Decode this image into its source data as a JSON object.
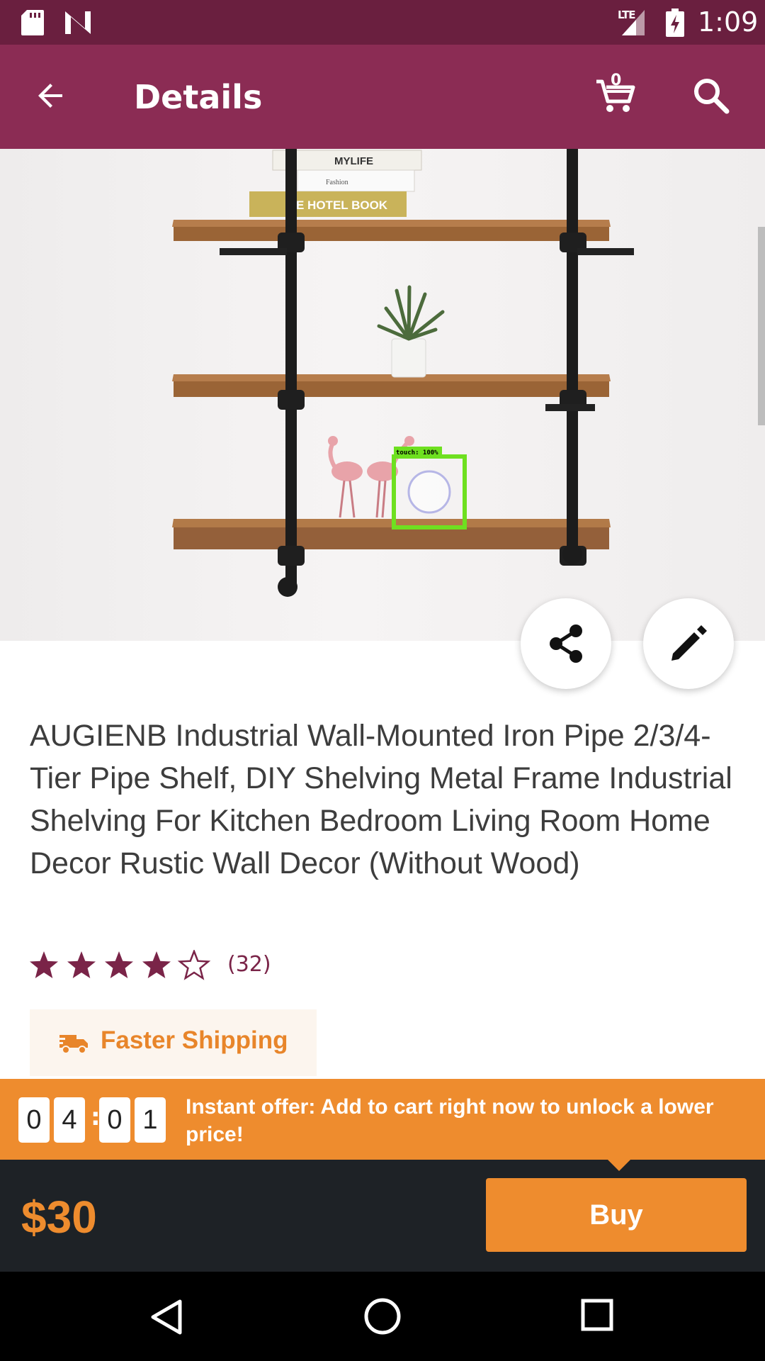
{
  "status_bar": {
    "network": "LTE",
    "time": "1:09"
  },
  "app_bar": {
    "title": "Details",
    "cart_count": "0",
    "icons": [
      "back-arrow-icon",
      "cart-icon",
      "search-icon"
    ]
  },
  "product": {
    "title": "AUGIENB Industrial Wall-Mounted Iron Pipe 2/3/4-Tier Pipe Shelf, DIY Shelving Metal Frame Industrial Shelving For Kitchen Bedroom Living Room Home Decor Rustic Wall Decor (Without Wood)",
    "rating": 4,
    "rating_max": 5,
    "review_count": "(32)",
    "image_text": {
      "book_1": "MYLIFE",
      "book_2": "Fashion",
      "book_3": "E HOTEL BOOK"
    }
  },
  "touch_overlay": {
    "label": "touch: 100%"
  },
  "shipping": {
    "label": "Faster Shipping",
    "icon": "truck-icon"
  },
  "offer": {
    "timer_digits": [
      "0",
      "4",
      "0",
      "1"
    ],
    "separator": ":",
    "text": "Instant offer: Add to cart right now to unlock a lower price!"
  },
  "buy_bar": {
    "price": "$30",
    "buy_label": "Buy"
  },
  "colors": {
    "status_bar": "#6a1f3f",
    "app_bar": "#8b2c54",
    "accent_orange": "#ee8c2e",
    "star": "#7a2448",
    "buy_bar_bg": "#1e2226"
  }
}
